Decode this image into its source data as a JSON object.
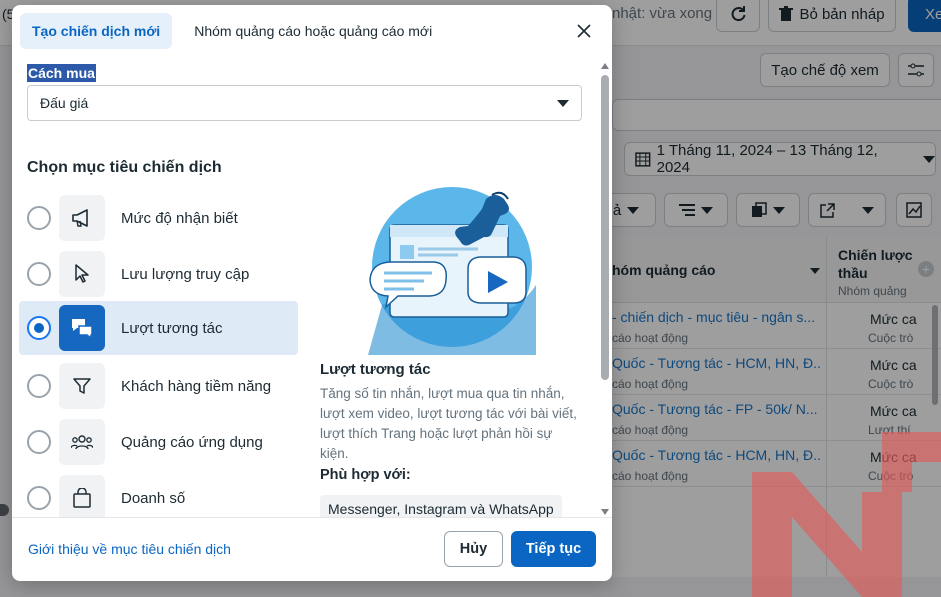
{
  "background": {
    "left_snippet": "(5",
    "update_status": "nhật: vừa xong",
    "discard_label": "Bỏ bản nháp",
    "publish_label": "Xe",
    "create_view_label": "Tạo chế độ xem",
    "date_range": "1 Tháng 11, 2024 – 13 Tháng 12, 2024",
    "filter_snippet": "ả",
    "col_adgroup": "hóm quảng cáo",
    "col_strategy": "Chiến lược thầu",
    "col_strategy_sub": "Nhóm quảng",
    "rows": [
      {
        "name": "- chiến dịch - mục tiêu - ngân s...",
        "status": "cáo hoạt động",
        "strategy": "Mức ca",
        "sub": "Cuộc trò"
      },
      {
        "name": "Quốc - Tương tác - HCM, HN, Đ...",
        "status": "cáo hoạt động",
        "strategy": "Mức ca",
        "sub": "Cuộc trò"
      },
      {
        "name": "Quốc - Tương tác - FP - 50k/ N...",
        "status": "cáo hoạt động",
        "strategy": "Mức ca",
        "sub": "Lượt thí"
      },
      {
        "name": "Quốc - Tương tác - HCM, HN, Đ...",
        "status": "cáo hoạt động",
        "strategy": "Mức ca",
        "sub": "Cuộc trò"
      }
    ]
  },
  "modal": {
    "tabs": [
      {
        "label": "Tạo chiến dịch mới",
        "active": true
      },
      {
        "label": "Nhóm quảng cáo hoặc quảng cáo mới",
        "active": false
      }
    ],
    "buying_type_label": "Cách mua",
    "buying_type_value": "Đấu giá",
    "objective_heading": "Chọn mục tiêu chiến dịch",
    "objectives": [
      {
        "label": "Mức độ nhận biết",
        "icon": "megaphone-icon",
        "selected": false
      },
      {
        "label": "Lưu lượng truy cập",
        "icon": "cursor-icon",
        "selected": false
      },
      {
        "label": "Lượt tương tác",
        "icon": "chat-bubbles-icon",
        "selected": true
      },
      {
        "label": "Khách hàng tiềm năng",
        "icon": "funnel-icon",
        "selected": false
      },
      {
        "label": "Quảng cáo ứng dụng",
        "icon": "people-icon",
        "selected": false
      },
      {
        "label": "Doanh số",
        "icon": "shopping-bag-icon",
        "selected": false
      }
    ],
    "detail": {
      "title": "Lượt tương tác",
      "description": "Tăng số tin nhắn, lượt mua qua tin nhắn, lượt xem video, lượt tương tác với bài viết, lượt thích Trang hoặc lượt phản hồi sự kiện.",
      "fit_label": "Phù hợp với:",
      "fit_chip": "Messenger, Instagram và WhatsApp"
    },
    "footer": {
      "learn_link": "Giới thiệu về mục tiêu chiến dịch",
      "cancel_label": "Hủy",
      "continue_label": "Tiếp tục"
    }
  },
  "colors": {
    "accent": "#0a66c2",
    "selected_bg": "#dfeaf7"
  }
}
